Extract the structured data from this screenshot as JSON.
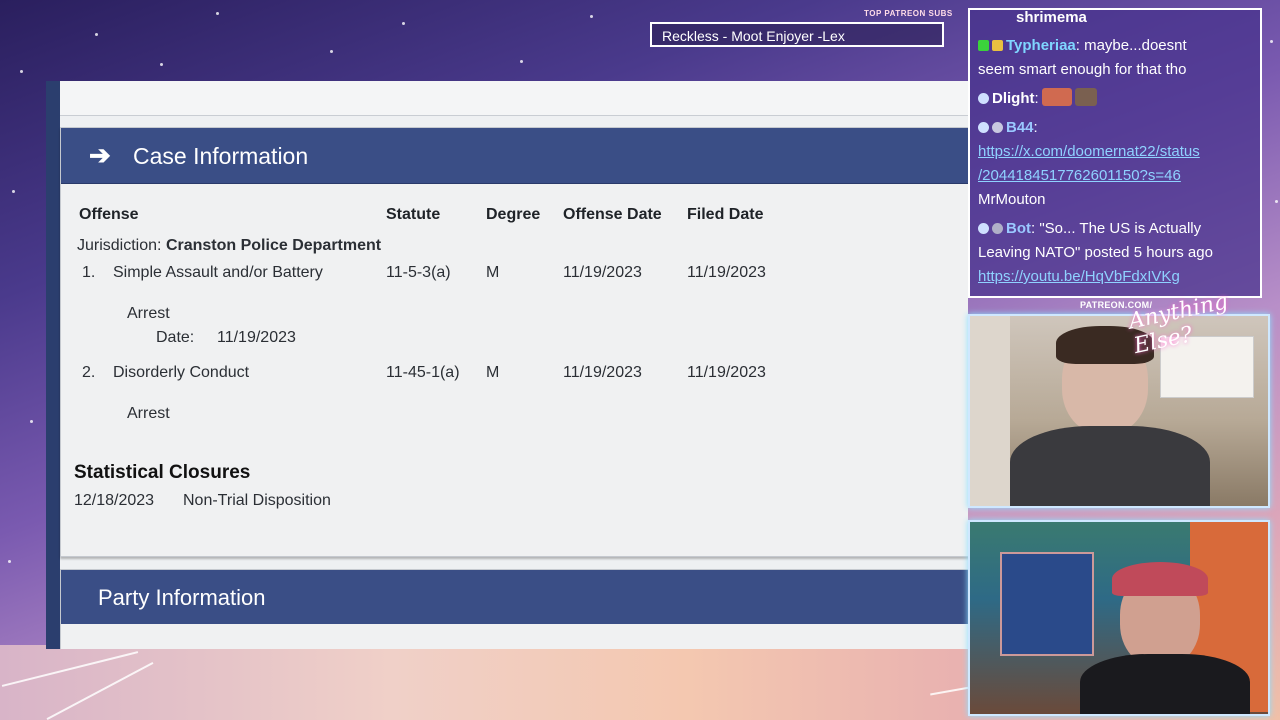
{
  "overlay": {
    "top_patreon_label": "TOP PATREON SUBS",
    "top_patreon_sub": "Reckless - Moot Enjoyer -Lex",
    "patreon_url_label": "PATREON.COM/",
    "logo_text": "Anything Else?"
  },
  "document": {
    "case_section_title": "Case Information",
    "table_headers": {
      "offense": "Offense",
      "statute": "Statute",
      "degree": "Degree",
      "offense_date": "Offense Date",
      "filed_date": "Filed Date"
    },
    "jurisdiction_label": "Jurisdiction:",
    "jurisdiction_value": "Cranston Police Department",
    "offenses": [
      {
        "number": "1.",
        "name": "Simple Assault and/or Battery",
        "statute": "11-5-3(a)",
        "degree": "M",
        "offense_date": "11/19/2023",
        "filed_date": "11/19/2023",
        "arrest_label": "Arrest",
        "arrest_date_label": "Date:",
        "arrest_date": "11/19/2023"
      },
      {
        "number": "2.",
        "name": "Disorderly Conduct",
        "statute": "11-45-1(a)",
        "degree": "M",
        "offense_date": "11/19/2023",
        "filed_date": "11/19/2023",
        "arrest_label": "Arrest"
      }
    ],
    "closures_title": "Statistical Closures",
    "closure_date": "12/18/2023",
    "closure_desc": "Non-Trial Disposition",
    "party_section_title": "Party Information"
  },
  "chat": {
    "messages": [
      {
        "user": "shrimema",
        "text": ""
      },
      {
        "user": "Typheriaa",
        "text": "maybe...doesnt"
      },
      {
        "user": "",
        "text": "seem smart enough for that tho"
      },
      {
        "user": "Dlight",
        "text": ""
      },
      {
        "user": "B44",
        "text": ""
      },
      {
        "user": "",
        "text": "https://x.com/doomernat22/status"
      },
      {
        "user": "",
        "text": "/2044184517762601150?s=46"
      },
      {
        "user": "",
        "text": "MrMouton"
      },
      {
        "user": "Bot",
        "text": "\"So... The US is Actually"
      },
      {
        "user": "",
        "text": "Leaving NATO\" posted 5 hours ago"
      },
      {
        "user": "",
        "text": "https://youtu.be/HqVbFdxIVKg"
      }
    ]
  }
}
